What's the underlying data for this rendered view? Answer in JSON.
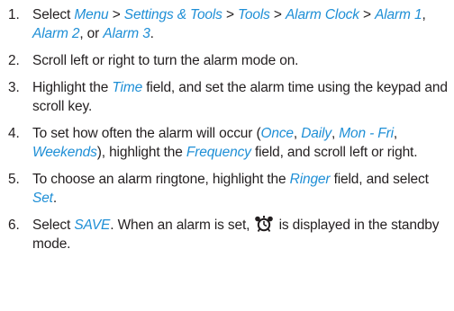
{
  "steps": [
    {
      "number": "1.",
      "parts": [
        {
          "t": "Select "
        },
        {
          "t": "Menu",
          "hl": true
        },
        {
          "t": " > "
        },
        {
          "t": "Settings & Tools",
          "hl": true
        },
        {
          "t": " > "
        },
        {
          "t": "Tools",
          "hl": true
        },
        {
          "t": " > "
        },
        {
          "t": "Alarm Clock",
          "hl": true
        },
        {
          "t": " > "
        },
        {
          "t": "Alarm 1",
          "hl": true
        },
        {
          "t": ", "
        },
        {
          "t": "Alarm 2",
          "hl": true
        },
        {
          "t": ", or "
        },
        {
          "t": "Alarm 3",
          "hl": true
        },
        {
          "t": "."
        }
      ]
    },
    {
      "number": "2.",
      "parts": [
        {
          "t": "Scroll left or right to turn the alarm mode on."
        }
      ]
    },
    {
      "number": "3.",
      "parts": [
        {
          "t": "Highlight the "
        },
        {
          "t": "Time",
          "hl": true
        },
        {
          "t": " field, and set the alarm time using the keypad and scroll key."
        }
      ]
    },
    {
      "number": "4.",
      "parts": [
        {
          "t": "To set how often the alarm will occur ("
        },
        {
          "t": "Once",
          "hl": true
        },
        {
          "t": ", "
        },
        {
          "t": "Daily",
          "hl": true
        },
        {
          "t": ", "
        },
        {
          "t": "Mon - Fri",
          "hl": true
        },
        {
          "t": ", "
        },
        {
          "t": "Weekends",
          "hl": true
        },
        {
          "t": "), highlight the "
        },
        {
          "t": "Frequency",
          "hl": true
        },
        {
          "t": " field, and scroll left or right."
        }
      ]
    },
    {
      "number": "5.",
      "parts": [
        {
          "t": "To choose an alarm ringtone, highlight the "
        },
        {
          "t": "Ringer",
          "hl": true
        },
        {
          "t": " field, and select "
        },
        {
          "t": "Set",
          "hl": true
        },
        {
          "t": "."
        }
      ]
    },
    {
      "number": "6.",
      "parts": [
        {
          "t": "Select "
        },
        {
          "t": "SAVE",
          "hl": true
        },
        {
          "t": ". When an alarm is set, "
        },
        {
          "icon": "alarm-clock-icon"
        },
        {
          "t": " is displayed in the standby mode."
        }
      ]
    }
  ],
  "colors": {
    "text": "#231f20",
    "highlight": "#1f8fd6",
    "icon": "#231f20"
  }
}
